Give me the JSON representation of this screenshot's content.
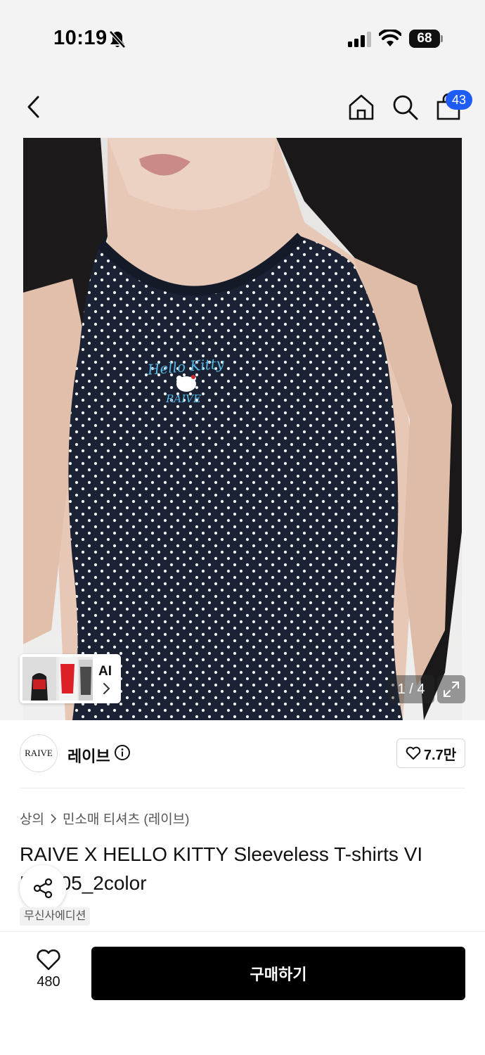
{
  "status_bar": {
    "time": "10:19",
    "battery": "68",
    "icons": [
      "bell-off-icon",
      "signal-icon",
      "wifi-icon",
      "battery-icon"
    ]
  },
  "header": {
    "icons": [
      "chevron-left-icon",
      "home-icon",
      "search-icon",
      "shopping-bag-icon"
    ],
    "cart_badge": "43"
  },
  "gallery": {
    "ai_label": "AI",
    "page_indicator": "1 / 4",
    "graphic_text": [
      "Hello Kitty",
      "RAIVE"
    ]
  },
  "brand": {
    "logo_text": "RAIVE",
    "name": "레이브",
    "like_count": "7.7만"
  },
  "breadcrumb": {
    "level1": "상의",
    "level2": "민소매 티셔츠 (레이브)"
  },
  "product": {
    "title": "RAIVE X HELLO KITTY Sleeveless T-shirts VI ME005_2color",
    "tag": "무신사에디션"
  },
  "bottom_bar": {
    "wish_count": "480",
    "buy_label": "구매하기"
  },
  "colors": {
    "accent": "#1f5cf5",
    "buy_button": "#000000",
    "shirt": "#1b2233"
  }
}
